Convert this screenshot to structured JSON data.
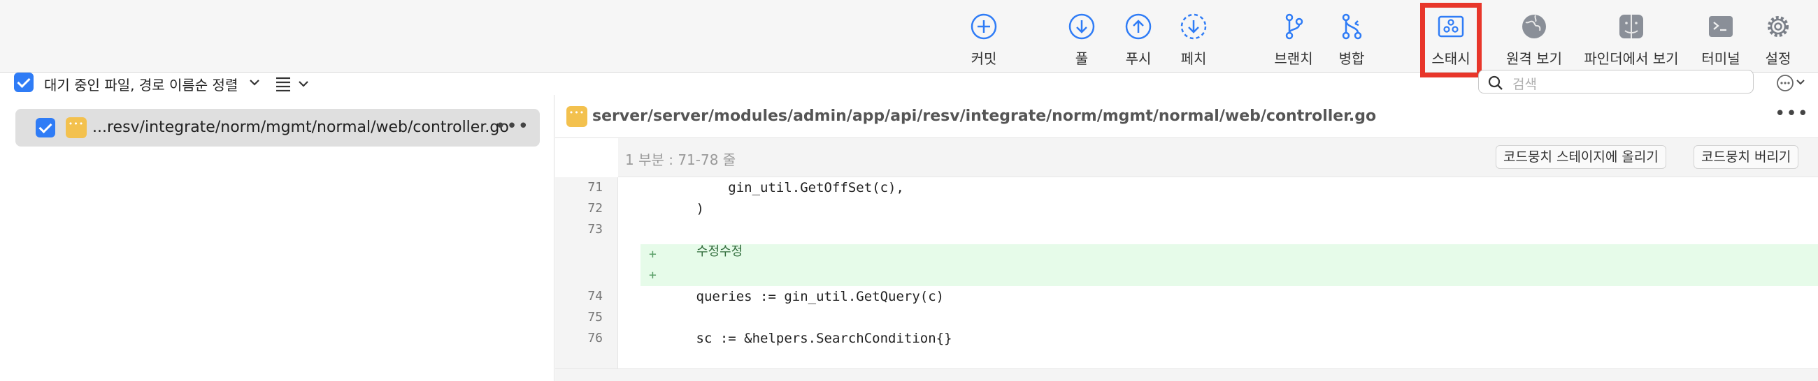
{
  "toolbar": {
    "commit": "커밋",
    "pull": "풀",
    "push": "푸시",
    "fetch": "페치",
    "branch": "브랜치",
    "merge": "병합",
    "stash": "스태시",
    "remote": "원격 보기",
    "finder": "파인더에서 보기",
    "terminal": "터미널",
    "settings": "설정"
  },
  "subbar": {
    "sort_label": "대기 중인 파일, 경로 이름순 정렬",
    "search_placeholder": "검색"
  },
  "file_list": {
    "items": [
      {
        "name": "...resv/integrate/norm/mgmt/normal/web/controller.go",
        "more": "•••"
      }
    ]
  },
  "diff": {
    "path": "server/server/modules/admin/app/api/resv/integrate/norm/mgmt/normal/web/controller.go",
    "more": "•••",
    "hunk_title": "1 부분 : 71-78 줄",
    "stage_hunk": "코드뭉치 스테이지에 올리기",
    "discard_hunk": "코드뭉치 버리기",
    "lines": [
      {
        "num": "71",
        "text": "            gin_util.GetOffSet(c),"
      },
      {
        "num": "72",
        "text": "        )"
      },
      {
        "num": "73",
        "text": ""
      },
      {
        "num": "",
        "plus": "+",
        "text": "수정수정"
      },
      {
        "num": "",
        "plus": "+",
        "text": ""
      },
      {
        "num": "74",
        "text": "        queries := gin_util.GetQuery(c)"
      },
      {
        "num": "75",
        "text": ""
      },
      {
        "num": "76",
        "text": "        sc := &helpers.SearchCondition{}"
      }
    ]
  },
  "colors": {
    "accent": "#2f7cf6",
    "highlight": "#e8362a",
    "added_bg": "#e6fbe9",
    "badge": "#f3c14e"
  }
}
